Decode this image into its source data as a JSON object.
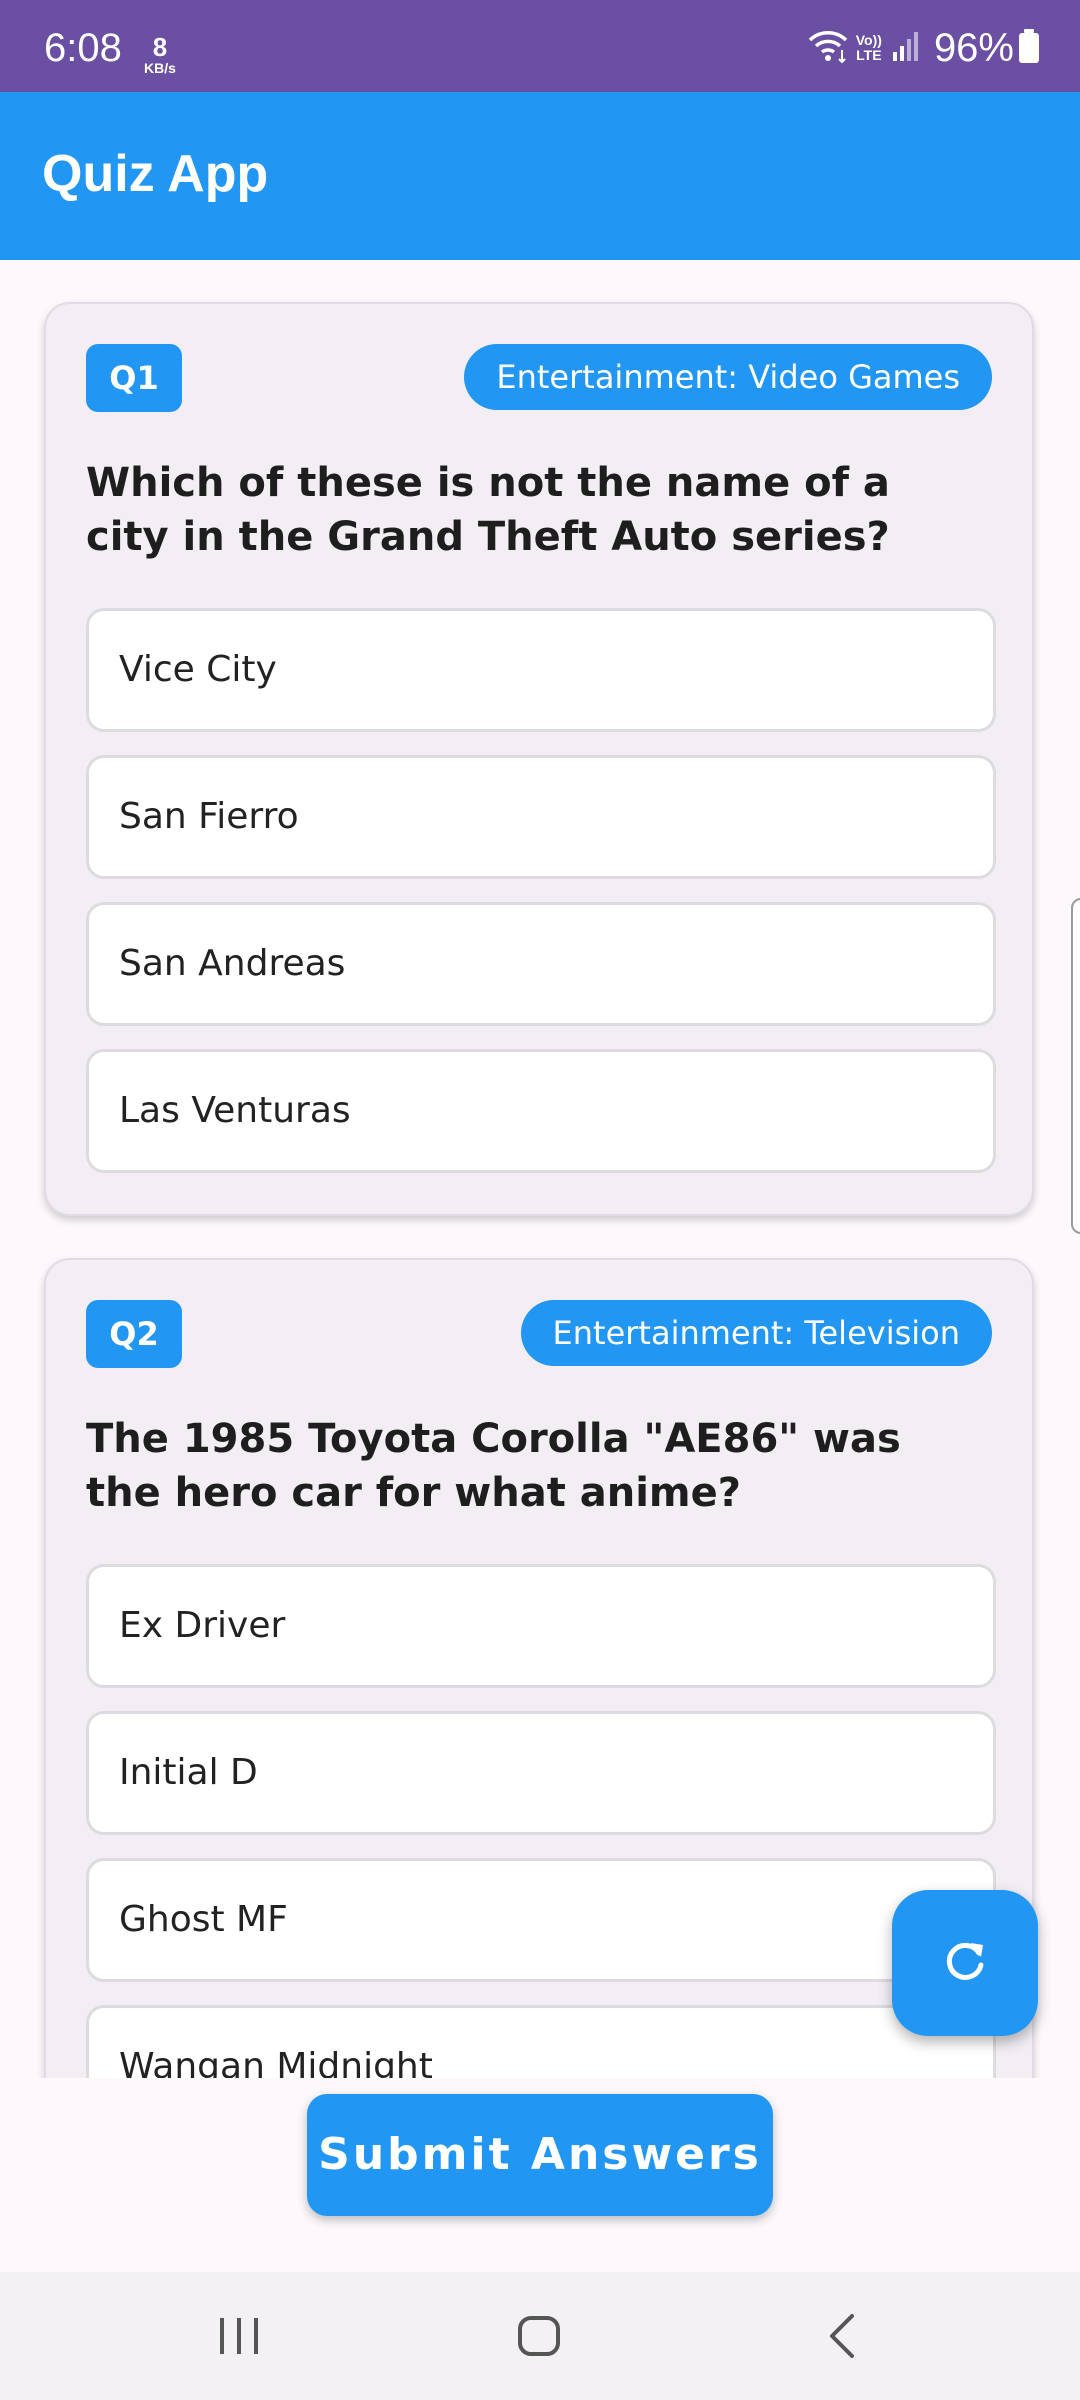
{
  "status_bar": {
    "time": "6:08",
    "net_speed_value": "8",
    "net_speed_unit": "KB/s",
    "lte_top": "Vo))",
    "lte_bottom": "LTE",
    "battery": "96%",
    "icons": [
      "wifi-icon",
      "signal-icon",
      "battery-icon"
    ]
  },
  "app_bar": {
    "title": "Quiz App",
    "color": "#2196f3"
  },
  "questions": [
    {
      "badge": "Q1",
      "category": "Entertainment: Video Games",
      "text": "Which of these is not the name of a city in the Grand Theft Auto series?",
      "options": [
        "Vice City",
        "San Fierro",
        "San Andreas",
        "Las Venturas"
      ]
    },
    {
      "badge": "Q2",
      "category": "Entertainment: Television",
      "text": "The 1985 Toyota Corolla \"AE86\" was the hero car for what anime?",
      "options": [
        "Ex Driver",
        "Initial D",
        "Ghost MF",
        "Wangan Midnight"
      ]
    }
  ],
  "fab": {
    "icon": "refresh-icon"
  },
  "submit": {
    "label": "Submit Answers"
  },
  "nav": {
    "icons": [
      "recents-icon",
      "home-icon",
      "back-icon"
    ]
  },
  "colors": {
    "status_bar": "#6a4fa3",
    "accent": "#2196f3"
  }
}
